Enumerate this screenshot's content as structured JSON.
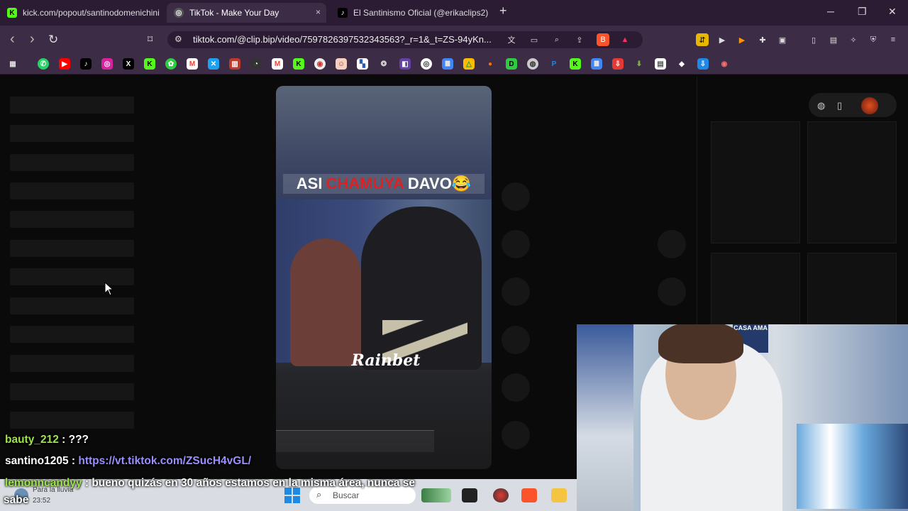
{
  "browser": {
    "tabs": [
      {
        "label": "kick.com/popout/santinodomenichini",
        "active": false
      },
      {
        "label": "TikTok - Make Your Day",
        "active": true
      },
      {
        "label": "El Santinismo Oficial (@erikaclips2) |",
        "active": false
      }
    ],
    "new_tab": "+",
    "window_controls": {
      "minimize": "─",
      "restore": "❐",
      "close": "✕"
    },
    "tab_close": "×",
    "url": "tiktok.com/@clip.bip/video/7597826397532343563?_r=1&_t=ZS-94yKn...",
    "nav": {
      "back": "‹",
      "forward": "›",
      "reload": "↻"
    }
  },
  "video": {
    "overlay_words": [
      "ASI",
      "CHAMUYA",
      "DAVO😂"
    ],
    "watermark": "Rainbet",
    "accent_red": "#e02020"
  },
  "chat": [
    {
      "user": "bauty_212",
      "sep": " : ",
      "message": "???"
    },
    {
      "user": "santino1205",
      "sep": " : ",
      "message": "https://vt.tiktok.com/ZSucH4vGL/"
    },
    {
      "user": "lemonncandyy",
      "sep": " : ",
      "message": "bueno quizás en 30 años estamos en la misma área, nunca se",
      "continuation": "sabe"
    }
  ],
  "taskbar": {
    "weather": "Para la lluvia",
    "time": "23:52",
    "search_placeholder": "Buscar"
  },
  "webcam": {
    "sign_text": "CASA AMA"
  },
  "colors": {
    "tab_bg": "#2b1b33",
    "toolbar_bg": "#3d2c46",
    "username": "#9de34a",
    "link": "#9a8fff"
  }
}
